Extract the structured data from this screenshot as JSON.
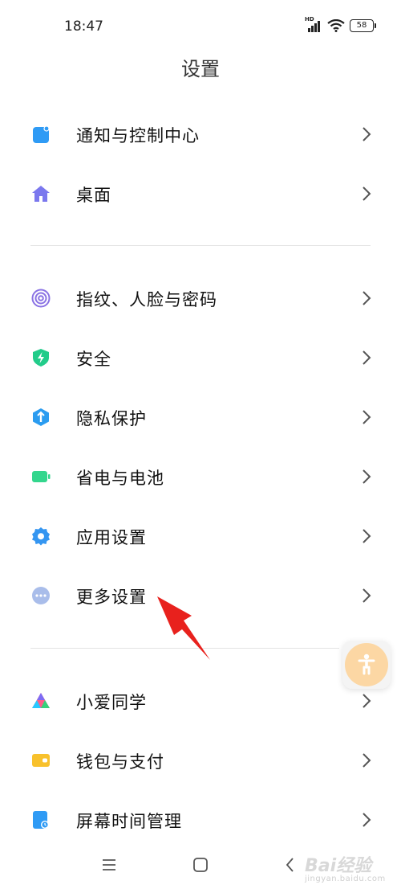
{
  "status_bar": {
    "time": "18:47",
    "network_badge": "HD",
    "battery_level": "58"
  },
  "page": {
    "title": "设置"
  },
  "sections": [
    {
      "items": [
        {
          "label": "通知与控制中心",
          "icon": "notification-icon",
          "color": "#2f9bf5"
        },
        {
          "label": "桌面",
          "icon": "home-icon",
          "color": "#7b78ee"
        }
      ]
    },
    {
      "items": [
        {
          "label": "指纹、人脸与密码",
          "icon": "fingerprint-icon",
          "color": "#8a72e4"
        },
        {
          "label": "安全",
          "icon": "security-shield-icon",
          "color": "#22cc8a"
        },
        {
          "label": "隐私保护",
          "icon": "privacy-icon",
          "color": "#2b9cf0"
        },
        {
          "label": "省电与电池",
          "icon": "battery-icon",
          "color": "#33d68d"
        },
        {
          "label": "应用设置",
          "icon": "gear-icon",
          "color": "#3596f1"
        },
        {
          "label": "更多设置",
          "icon": "more-dots-icon",
          "color": "#a9bdea"
        }
      ]
    },
    {
      "items": [
        {
          "label": "小爱同学",
          "icon": "xiaoai-icon",
          "color": "#ff5c8a"
        },
        {
          "label": "钱包与支付",
          "icon": "wallet-icon",
          "color": "#f8c12c"
        },
        {
          "label": "屏幕时间管理",
          "icon": "screen-time-icon",
          "color": "#2f9bf5"
        }
      ]
    }
  ],
  "watermark": {
    "brand": "Bai经验",
    "url": "jingyan.baidu.com"
  }
}
